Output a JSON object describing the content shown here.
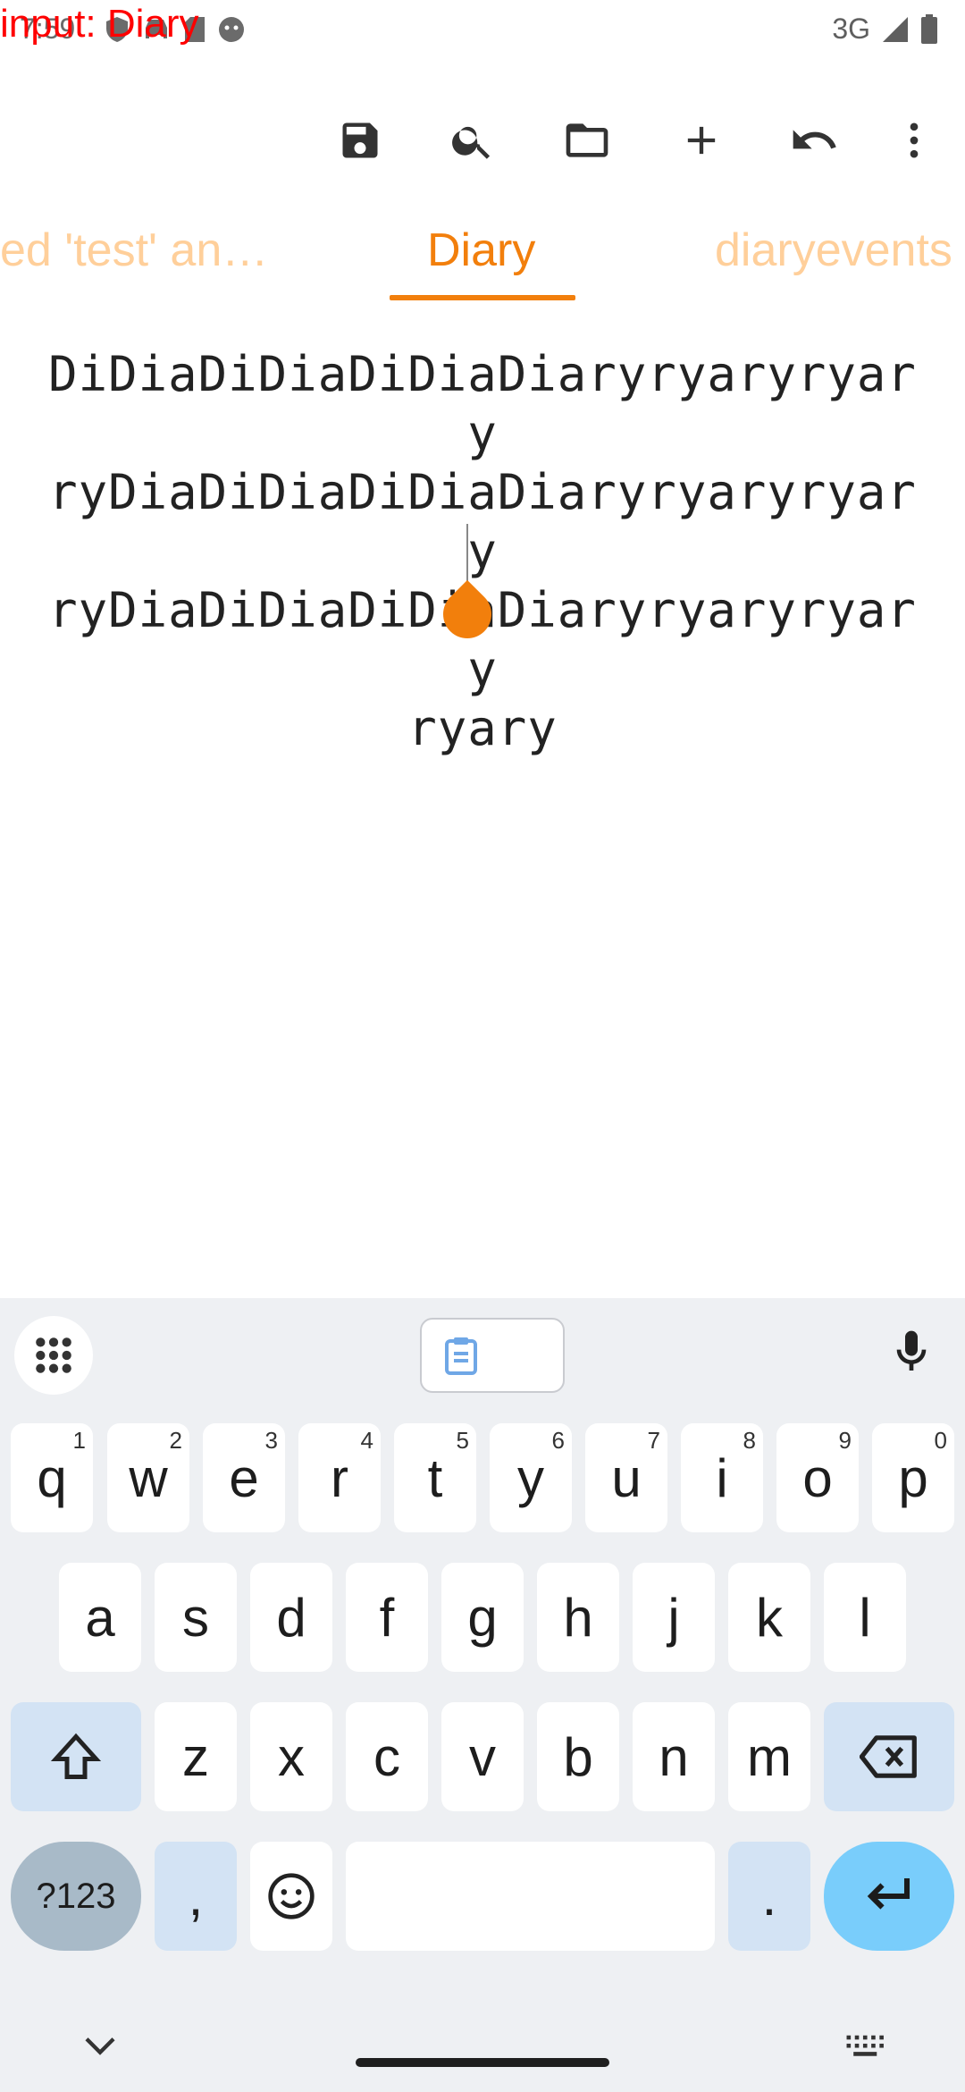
{
  "debug_label": "input: Diary",
  "status_bar": {
    "time": "7:59",
    "network": "3G"
  },
  "toolbar": {
    "icons": [
      "save-icon",
      "search-icon",
      "folder-icon",
      "add-icon",
      "undo-icon",
      "more-vert-icon"
    ]
  },
  "tabs": [
    {
      "label": "ed 'test' an…",
      "active": false
    },
    {
      "label": "Diary",
      "active": true
    },
    {
      "label": "diaryevents",
      "active": false
    }
  ],
  "editor": {
    "lines": [
      "DiDiaDiDiaDiDiaDiaryryaryryary",
      "ryDiaDiDiaDiDiaDiaryryaryryary",
      "ryDiaDiDiaDiDiaDiaryryaryryary",
      "ryary"
    ]
  },
  "keyboard": {
    "row1": [
      {
        "k": "q",
        "h": "1"
      },
      {
        "k": "w",
        "h": "2"
      },
      {
        "k": "e",
        "h": "3"
      },
      {
        "k": "r",
        "h": "4"
      },
      {
        "k": "t",
        "h": "5"
      },
      {
        "k": "y",
        "h": "6"
      },
      {
        "k": "u",
        "h": "7"
      },
      {
        "k": "i",
        "h": "8"
      },
      {
        "k": "o",
        "h": "9"
      },
      {
        "k": "p",
        "h": "0"
      }
    ],
    "row2": [
      "a",
      "s",
      "d",
      "f",
      "g",
      "h",
      "j",
      "k",
      "l"
    ],
    "row3": [
      "z",
      "x",
      "c",
      "v",
      "b",
      "n",
      "m"
    ],
    "sym_label": "?123",
    "comma_label": ",",
    "period_label": "."
  },
  "colors": {
    "accent": "#f27f0c",
    "tab_inactive": "#ffcf9a",
    "keyboard_bg": "#eef0f3"
  }
}
